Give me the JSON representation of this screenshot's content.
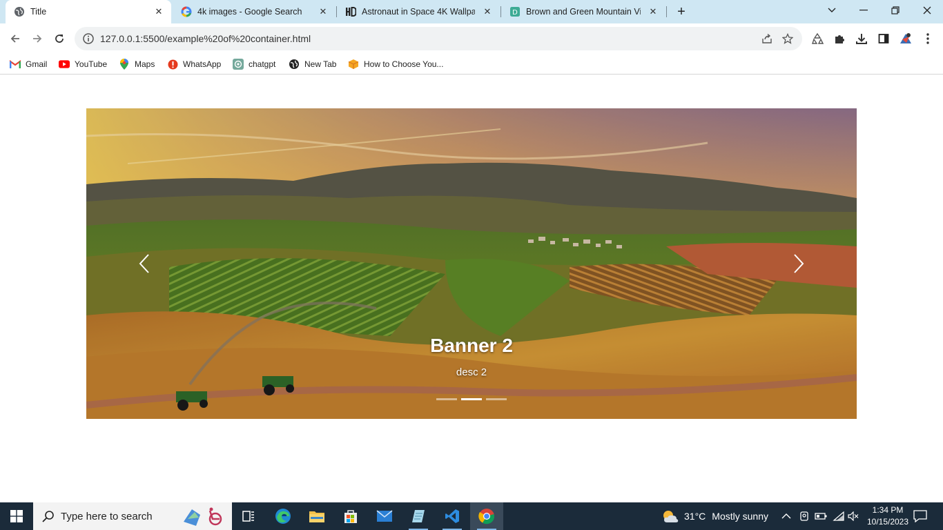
{
  "browser": {
    "tabs": [
      {
        "title": "Title",
        "favicon": "globe-icon",
        "active": true
      },
      {
        "title": "4k images - Google Search",
        "favicon": "google-icon",
        "active": false
      },
      {
        "title": "Astronaut in Space 4K Wallpape",
        "favicon": "hd-icon",
        "active": false
      },
      {
        "title": "Brown and Green Mountain View",
        "favicon": "d-icon",
        "active": false
      }
    ],
    "new_tab_label": "+",
    "url": "127.0.0.1:5500/example%20of%20container.html"
  },
  "bookmarks": [
    {
      "label": "Gmail",
      "icon": "gmail-icon"
    },
    {
      "label": "YouTube",
      "icon": "youtube-icon"
    },
    {
      "label": "Maps",
      "icon": "maps-icon"
    },
    {
      "label": "WhatsApp",
      "icon": "whatsapp-icon"
    },
    {
      "label": "chatgpt",
      "icon": "chatgpt-icon"
    },
    {
      "label": "New Tab",
      "icon": "globe-icon"
    },
    {
      "label": "How to Choose You...",
      "icon": "box-icon"
    }
  ],
  "carousel": {
    "caption_title": "Banner 2",
    "caption_desc": "desc 2",
    "slide_count": 3,
    "active_index": 1
  },
  "taskbar": {
    "search_placeholder": "Type here to search",
    "weather_temp": "31°C",
    "weather_text": "Mostly sunny",
    "time": "1:34 PM",
    "date": "10/15/2023"
  },
  "colors": {
    "tabstrip": "#cfe7f3",
    "taskbar": "#1b2b3a",
    "taskbar_accent": "#7fb6e6"
  }
}
